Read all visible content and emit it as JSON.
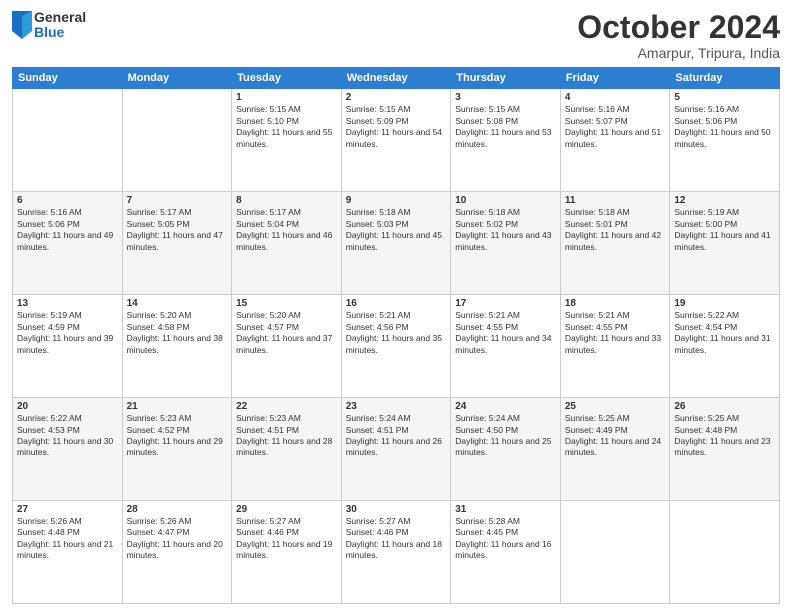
{
  "logo": {
    "general": "General",
    "blue": "Blue"
  },
  "title": "October 2024",
  "location": "Amarpur, Tripura, India",
  "headers": [
    "Sunday",
    "Monday",
    "Tuesday",
    "Wednesday",
    "Thursday",
    "Friday",
    "Saturday"
  ],
  "weeks": [
    [
      {
        "day": "",
        "sunrise": "",
        "sunset": "",
        "daylight": ""
      },
      {
        "day": "",
        "sunrise": "",
        "sunset": "",
        "daylight": ""
      },
      {
        "day": "1",
        "sunrise": "Sunrise: 5:15 AM",
        "sunset": "Sunset: 5:10 PM",
        "daylight": "Daylight: 11 hours and 55 minutes."
      },
      {
        "day": "2",
        "sunrise": "Sunrise: 5:15 AM",
        "sunset": "Sunset: 5:09 PM",
        "daylight": "Daylight: 11 hours and 54 minutes."
      },
      {
        "day": "3",
        "sunrise": "Sunrise: 5:15 AM",
        "sunset": "Sunset: 5:08 PM",
        "daylight": "Daylight: 11 hours and 53 minutes."
      },
      {
        "day": "4",
        "sunrise": "Sunrise: 5:16 AM",
        "sunset": "Sunset: 5:07 PM",
        "daylight": "Daylight: 11 hours and 51 minutes."
      },
      {
        "day": "5",
        "sunrise": "Sunrise: 5:16 AM",
        "sunset": "Sunset: 5:06 PM",
        "daylight": "Daylight: 11 hours and 50 minutes."
      }
    ],
    [
      {
        "day": "6",
        "sunrise": "Sunrise: 5:16 AM",
        "sunset": "Sunset: 5:06 PM",
        "daylight": "Daylight: 11 hours and 49 minutes."
      },
      {
        "day": "7",
        "sunrise": "Sunrise: 5:17 AM",
        "sunset": "Sunset: 5:05 PM",
        "daylight": "Daylight: 11 hours and 47 minutes."
      },
      {
        "day": "8",
        "sunrise": "Sunrise: 5:17 AM",
        "sunset": "Sunset: 5:04 PM",
        "daylight": "Daylight: 11 hours and 46 minutes."
      },
      {
        "day": "9",
        "sunrise": "Sunrise: 5:18 AM",
        "sunset": "Sunset: 5:03 PM",
        "daylight": "Daylight: 11 hours and 45 minutes."
      },
      {
        "day": "10",
        "sunrise": "Sunrise: 5:18 AM",
        "sunset": "Sunset: 5:02 PM",
        "daylight": "Daylight: 11 hours and 43 minutes."
      },
      {
        "day": "11",
        "sunrise": "Sunrise: 5:18 AM",
        "sunset": "Sunset: 5:01 PM",
        "daylight": "Daylight: 11 hours and 42 minutes."
      },
      {
        "day": "12",
        "sunrise": "Sunrise: 5:19 AM",
        "sunset": "Sunset: 5:00 PM",
        "daylight": "Daylight: 11 hours and 41 minutes."
      }
    ],
    [
      {
        "day": "13",
        "sunrise": "Sunrise: 5:19 AM",
        "sunset": "Sunset: 4:59 PM",
        "daylight": "Daylight: 11 hours and 39 minutes."
      },
      {
        "day": "14",
        "sunrise": "Sunrise: 5:20 AM",
        "sunset": "Sunset: 4:58 PM",
        "daylight": "Daylight: 11 hours and 38 minutes."
      },
      {
        "day": "15",
        "sunrise": "Sunrise: 5:20 AM",
        "sunset": "Sunset: 4:57 PM",
        "daylight": "Daylight: 11 hours and 37 minutes."
      },
      {
        "day": "16",
        "sunrise": "Sunrise: 5:21 AM",
        "sunset": "Sunset: 4:56 PM",
        "daylight": "Daylight: 11 hours and 35 minutes."
      },
      {
        "day": "17",
        "sunrise": "Sunrise: 5:21 AM",
        "sunset": "Sunset: 4:55 PM",
        "daylight": "Daylight: 11 hours and 34 minutes."
      },
      {
        "day": "18",
        "sunrise": "Sunrise: 5:21 AM",
        "sunset": "Sunset: 4:55 PM",
        "daylight": "Daylight: 11 hours and 33 minutes."
      },
      {
        "day": "19",
        "sunrise": "Sunrise: 5:22 AM",
        "sunset": "Sunset: 4:54 PM",
        "daylight": "Daylight: 11 hours and 31 minutes."
      }
    ],
    [
      {
        "day": "20",
        "sunrise": "Sunrise: 5:22 AM",
        "sunset": "Sunset: 4:53 PM",
        "daylight": "Daylight: 11 hours and 30 minutes."
      },
      {
        "day": "21",
        "sunrise": "Sunrise: 5:23 AM",
        "sunset": "Sunset: 4:52 PM",
        "daylight": "Daylight: 11 hours and 29 minutes."
      },
      {
        "day": "22",
        "sunrise": "Sunrise: 5:23 AM",
        "sunset": "Sunset: 4:51 PM",
        "daylight": "Daylight: 11 hours and 28 minutes."
      },
      {
        "day": "23",
        "sunrise": "Sunrise: 5:24 AM",
        "sunset": "Sunset: 4:51 PM",
        "daylight": "Daylight: 11 hours and 26 minutes."
      },
      {
        "day": "24",
        "sunrise": "Sunrise: 5:24 AM",
        "sunset": "Sunset: 4:50 PM",
        "daylight": "Daylight: 11 hours and 25 minutes."
      },
      {
        "day": "25",
        "sunrise": "Sunrise: 5:25 AM",
        "sunset": "Sunset: 4:49 PM",
        "daylight": "Daylight: 11 hours and 24 minutes."
      },
      {
        "day": "26",
        "sunrise": "Sunrise: 5:25 AM",
        "sunset": "Sunset: 4:48 PM",
        "daylight": "Daylight: 11 hours and 23 minutes."
      }
    ],
    [
      {
        "day": "27",
        "sunrise": "Sunrise: 5:26 AM",
        "sunset": "Sunset: 4:48 PM",
        "daylight": "Daylight: 11 hours and 21 minutes."
      },
      {
        "day": "28",
        "sunrise": "Sunrise: 5:26 AM",
        "sunset": "Sunset: 4:47 PM",
        "daylight": "Daylight: 11 hours and 20 minutes."
      },
      {
        "day": "29",
        "sunrise": "Sunrise: 5:27 AM",
        "sunset": "Sunset: 4:46 PM",
        "daylight": "Daylight: 11 hours and 19 minutes."
      },
      {
        "day": "30",
        "sunrise": "Sunrise: 5:27 AM",
        "sunset": "Sunset: 4:46 PM",
        "daylight": "Daylight: 11 hours and 18 minutes."
      },
      {
        "day": "31",
        "sunrise": "Sunrise: 5:28 AM",
        "sunset": "Sunset: 4:45 PM",
        "daylight": "Daylight: 11 hours and 16 minutes."
      },
      {
        "day": "",
        "sunrise": "",
        "sunset": "",
        "daylight": ""
      },
      {
        "day": "",
        "sunrise": "",
        "sunset": "",
        "daylight": ""
      }
    ]
  ]
}
